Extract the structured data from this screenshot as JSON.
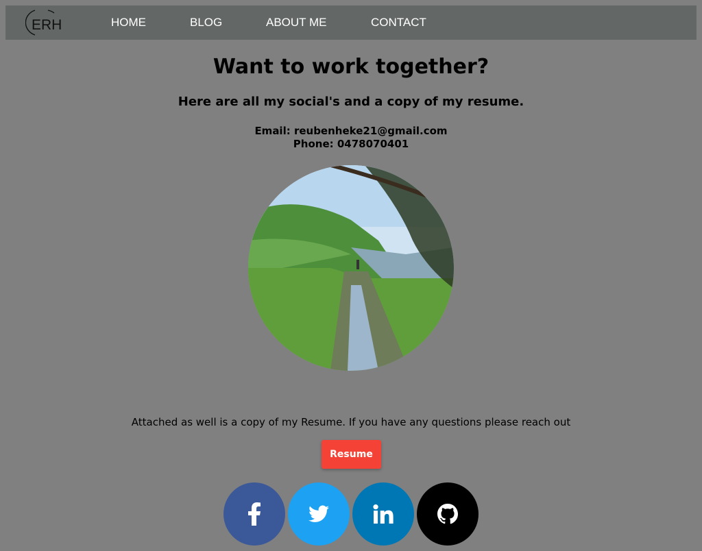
{
  "nav": {
    "logo_text": "ERH",
    "links": [
      "HOME",
      "BLOG",
      "ABOUT ME",
      "CONTACT"
    ]
  },
  "main": {
    "title": "Want to work together?",
    "subtitle": "Here are all my social's and a copy of my resume.",
    "email": "Email: reubenheke21@gmail.com",
    "phone": "Phone: 0478070401",
    "note": "Attached as well is a copy of my Resume. If you have any questions please reach out",
    "resume_label": "Resume"
  },
  "social": [
    {
      "icon": "facebook-icon",
      "color": "#3b5998"
    },
    {
      "icon": "twitter-icon",
      "color": "#1da1f2"
    },
    {
      "icon": "linkedin-icon",
      "color": "#0077b5"
    },
    {
      "icon": "github-icon",
      "color": "#000000"
    }
  ],
  "colors": {
    "background": "#808080",
    "navbar": "#636766",
    "resume_button": "#f44336"
  }
}
